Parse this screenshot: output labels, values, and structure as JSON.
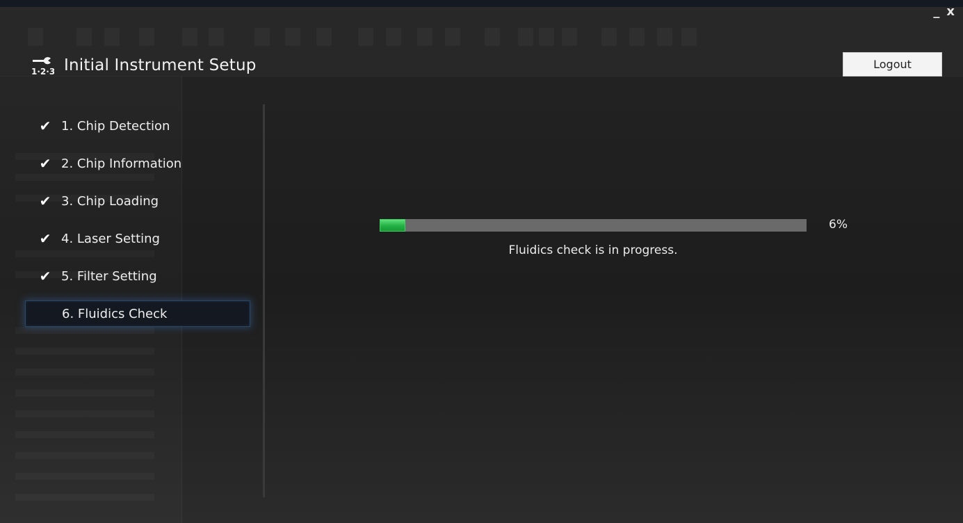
{
  "header": {
    "title": "Initial Instrument Setup",
    "logo_icon": "wrench-123-icon",
    "logo_text": "1·2·3"
  },
  "window": {
    "minimize_label": "_",
    "close_label": "x"
  },
  "logout": {
    "label": "Logout"
  },
  "steps": [
    {
      "label": "1. Chip Detection",
      "done": true
    },
    {
      "label": "2. Chip Information",
      "done": true
    },
    {
      "label": "3. Chip Loading",
      "done": true
    },
    {
      "label": "4. Laser Setting",
      "done": true
    },
    {
      "label": "5. Filter Setting",
      "done": true
    },
    {
      "label": "6. Fluidics Check",
      "done": false,
      "active": true
    }
  ],
  "check_glyph": "✔",
  "progress": {
    "percent": 6,
    "percent_label": "6%",
    "message": "Fluidics check is in progress."
  },
  "colors": {
    "progress_fill": "#22b043",
    "progress_track": "#6a6a6a",
    "active_glow": "#2b4763"
  }
}
